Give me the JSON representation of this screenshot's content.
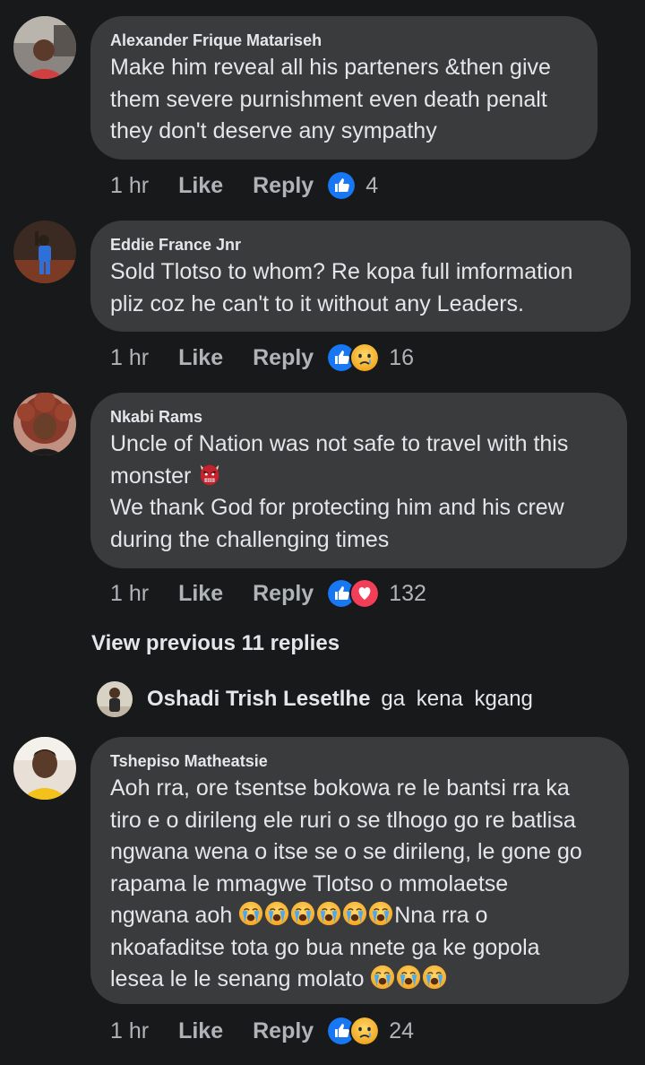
{
  "comments": [
    {
      "author": "Alexander Frique Matariseh",
      "lines": [
        "Make him reveal all his parteners &then give",
        "them severe purnishment even death penalt",
        "they don't deserve any sympathy"
      ],
      "time": "1 hr",
      "like": "Like",
      "reply": "Reply",
      "count": "4",
      "reactions": [
        "like-reaction-icon"
      ]
    },
    {
      "author": "Eddie France Jnr",
      "lines": [
        "Sold Tlotso to whom? Re kopa full imformation",
        "pliz coz he can't to it without any Leaders."
      ],
      "time": "1 hr",
      "like": "Like",
      "reply": "Reply",
      "count": "16",
      "reactions": [
        "like-reaction-icon",
        "sad-reaction-icon"
      ]
    },
    {
      "author": "Nkabi Rams",
      "line1": "Uncle of Nation was not safe to travel with this",
      "line2": "monster",
      "line3": "We thank God for protecting him and his crew",
      "line4": "during the challenging times",
      "time": "1 hr",
      "like": "Like",
      "reply": "Reply",
      "count": "132",
      "reactions": [
        "like-reaction-icon",
        "love-reaction-icon"
      ]
    },
    {
      "author": "Tshepiso Matheatsie",
      "line1": "Aoh rra, ore tsentse bokowa re le bantsi rra ka",
      "line2": "tiro e o dirileng ele ruri o se tlhogo go re batlisa",
      "line3": "ngwana wena o itse se o se dirileng, le gone go",
      "line4": "rapama le mmagwe Tlotso o mmolaetse",
      "line5a": "ngwana aoh",
      "line5b": "Nna rra o",
      "line6": "nkoafaditse tota go bua nnete ga ke gopola",
      "line7": "lesea le le senang molato",
      "time": "1 hr",
      "like": "Like",
      "reply": "Reply",
      "count": "24",
      "reactions": [
        "like-reaction-icon",
        "sad-reaction-icon"
      ]
    }
  ],
  "view_previous": "View previous 11 replies",
  "reply_preview": {
    "author": "Oshadi Trish Lesetlhe",
    "text": "ga  kena  kgang"
  },
  "colors": {
    "background": "#18191a",
    "bubble": "#3a3b3c",
    "like_blue": "#1877f2",
    "love_red": "#f33e58",
    "sad_yellow": "#f7b125"
  }
}
